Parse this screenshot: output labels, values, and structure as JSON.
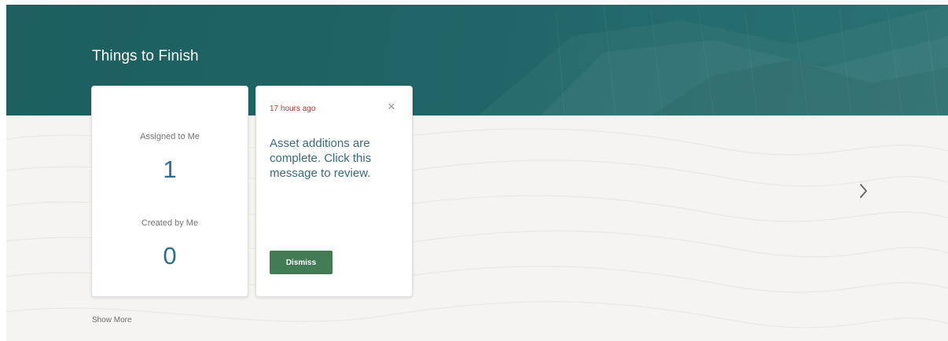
{
  "section": {
    "title": "Things to Finish"
  },
  "summary_card": {
    "assigned_label": "Assigned to Me",
    "assigned_count": "1",
    "created_label": "Created by Me",
    "created_count": "0"
  },
  "notification_card": {
    "timestamp": "17 hours ago",
    "message": "Asset additions are complete. Click this message to review.",
    "dismiss_label": "Dismiss",
    "close_icon": "close-icon"
  },
  "navigation": {
    "next_icon": "chevron-right-icon"
  },
  "footer": {
    "show_more_label": "Show More"
  },
  "colors": {
    "banner": "#1f6466",
    "accent_value": "#2f6f8d",
    "timestamp": "#b53b3b",
    "dismiss_button": "#427b54"
  }
}
